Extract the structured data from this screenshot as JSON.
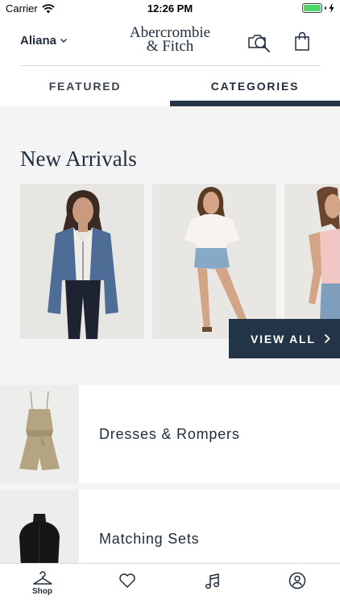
{
  "status_bar": {
    "carrier": "Carrier",
    "time": "12:26 PM",
    "battery_level": 1.0,
    "icons": [
      "wifi-icon",
      "battery-icon",
      "charging-bolt-icon"
    ]
  },
  "header": {
    "account_name": "Aliana",
    "logo_line1": "Abercrombie",
    "logo_line2": "& Fitch",
    "icons": [
      "chevron-down-icon",
      "visual-search-icon",
      "shopping-bag-icon"
    ]
  },
  "tabs": [
    {
      "label": "FEATURED",
      "selected": false
    },
    {
      "label": "CATEGORIES",
      "selected": true
    }
  ],
  "new_arrivals": {
    "title": "New Arrivals",
    "view_all_label": "VIEW ALL",
    "items": [
      "denim-jacket-outfit",
      "white-blouse-denim-shorts-outfit",
      "pink-top-denim-outfit"
    ]
  },
  "categories": [
    {
      "label": "Dresses & Rompers",
      "thumb": "olive-romper"
    },
    {
      "label": "Matching Sets",
      "thumb": "black-knit-top"
    }
  ],
  "bottom_nav": [
    {
      "label": "Shop",
      "icon": "hanger-icon",
      "active": true
    },
    {
      "label": "",
      "icon": "heart-icon",
      "active": false
    },
    {
      "label": "",
      "icon": "music-note-icon",
      "active": false
    },
    {
      "label": "",
      "icon": "profile-icon",
      "active": false
    }
  ],
  "colors": {
    "navy": "#243447",
    "text": "#1f2d3d",
    "background": "#f4f4f4",
    "battery_green": "#4cd964"
  }
}
